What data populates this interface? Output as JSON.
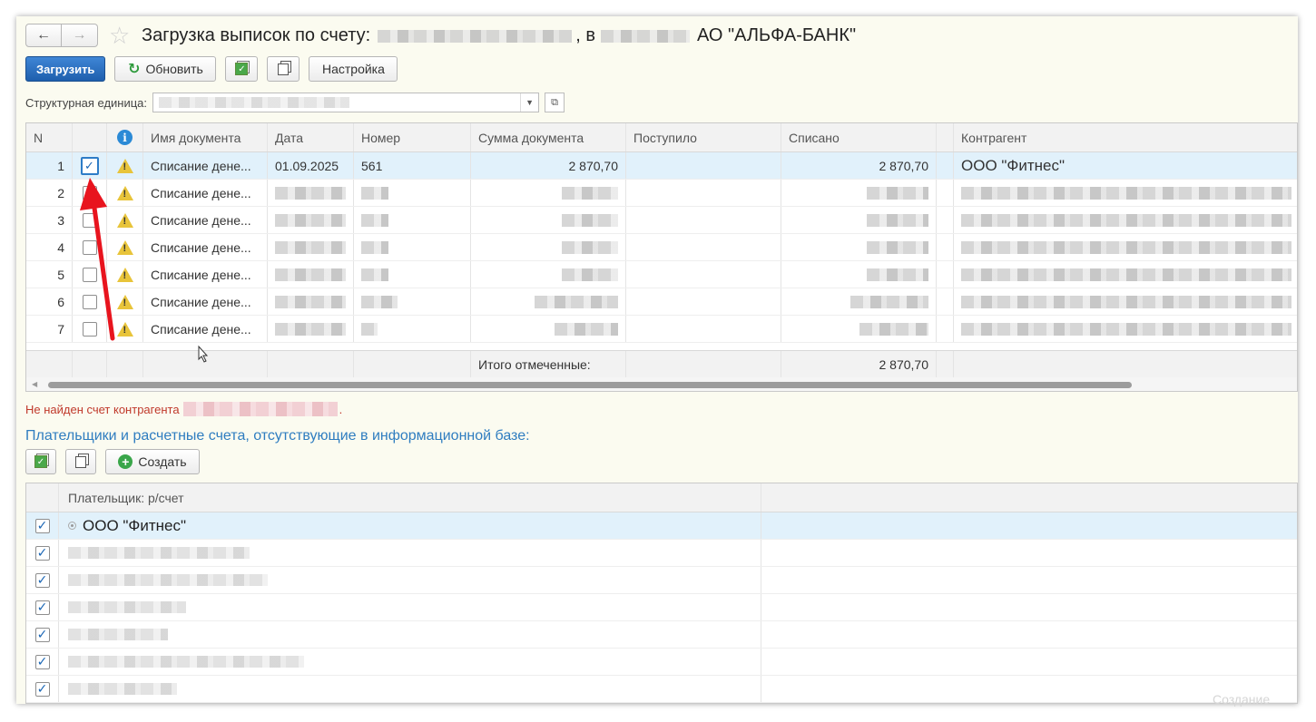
{
  "header": {
    "title_prefix": "Загрузка выписок по счету:",
    "title_mid": ", в",
    "title_bank": "АО \"АЛЬФА-БАНК\"",
    "back_icon": "arrow-left",
    "forward_icon": "arrow-right",
    "favorite_icon": "star"
  },
  "toolbar": {
    "load_label": "Загрузить",
    "refresh_label": "Обновить",
    "settings_label": "Настройка"
  },
  "struct": {
    "label": "Структурная единица:"
  },
  "table": {
    "columns": [
      "N",
      "",
      "",
      "Имя документа",
      "Дата",
      "Номер",
      "Сумма документа",
      "Поступило",
      "Списано",
      "Контрагент"
    ],
    "rows": [
      {
        "n": "1",
        "checked": true,
        "name": "Списание дене...",
        "date": "01.09.2025",
        "number": "561",
        "sum": "2 870,70",
        "in": "",
        "out": "2 870,70",
        "agent": "ООО \"Фитнес\""
      },
      {
        "n": "2",
        "checked": false,
        "name": "Списание дене..."
      },
      {
        "n": "3",
        "checked": false,
        "name": "Списание дене..."
      },
      {
        "n": "4",
        "checked": false,
        "name": "Списание дене..."
      },
      {
        "n": "5",
        "checked": false,
        "name": "Списание дене..."
      },
      {
        "n": "6",
        "checked": false,
        "name": "Списание дене..."
      },
      {
        "n": "7",
        "checked": false,
        "name": "Списание дене..."
      }
    ],
    "footer_label": "Итого отмеченные:",
    "footer_total": "2 870,70"
  },
  "error_text": "Не найден счет контрагента",
  "error_suffix": ".",
  "payers": {
    "title": "Плательщики и расчетные счета, отсутствующие в информационной базе:",
    "create_label": "Создать",
    "column": "Плательщик: р/счет",
    "first": "ООО \"Фитнес\""
  },
  "watermark": "Создание",
  "colors": {
    "accent": "#1e5fad",
    "selected_row": "#e1f1fb",
    "error": "#c0392b",
    "section_title": "#2f7dc0",
    "arrow": "#e8141e"
  }
}
